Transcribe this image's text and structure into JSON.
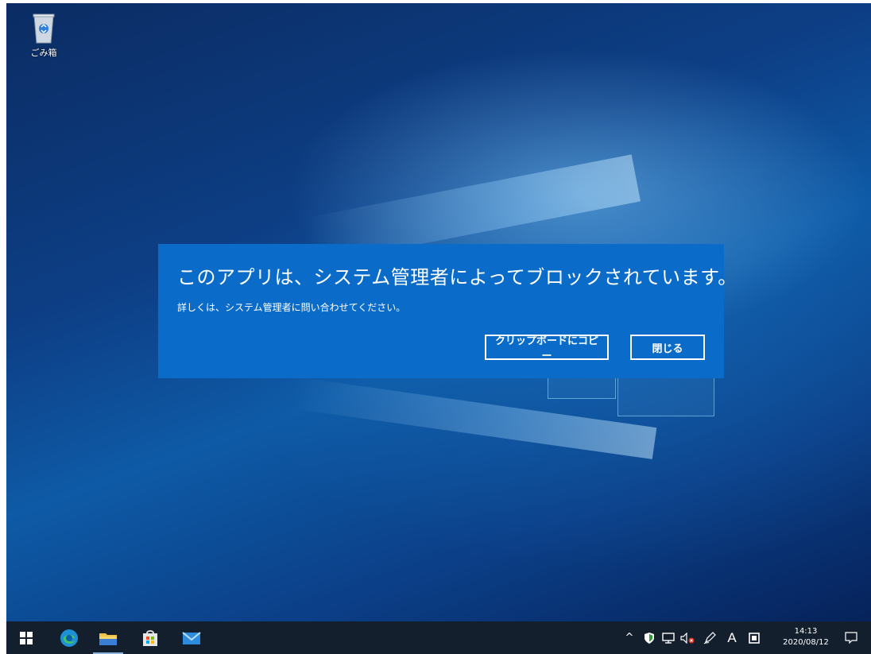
{
  "desktop": {
    "recycle_bin_label": "ごみ箱"
  },
  "dialog": {
    "title": "このアプリは、システム管理者によってブロックされています。",
    "message": "詳しくは、システム管理者に問い合わせてください。",
    "copy_button_label": "クリップボードにコピー",
    "close_button_label": "閉じる"
  },
  "taskbar": {
    "apps": [
      {
        "name": "start",
        "icon": "windows-logo-icon"
      },
      {
        "name": "edge",
        "icon": "edge-icon"
      },
      {
        "name": "file-explorer",
        "icon": "folder-icon"
      },
      {
        "name": "store",
        "icon": "store-icon"
      },
      {
        "name": "mail",
        "icon": "mail-icon"
      }
    ],
    "tray": {
      "chevron": "^",
      "ime_label": "A",
      "time": "14:13",
      "date": "2020/08/12"
    }
  },
  "colors": {
    "dialog_bg": "#0a6cc8",
    "taskbar_bg": "#141f2e"
  }
}
